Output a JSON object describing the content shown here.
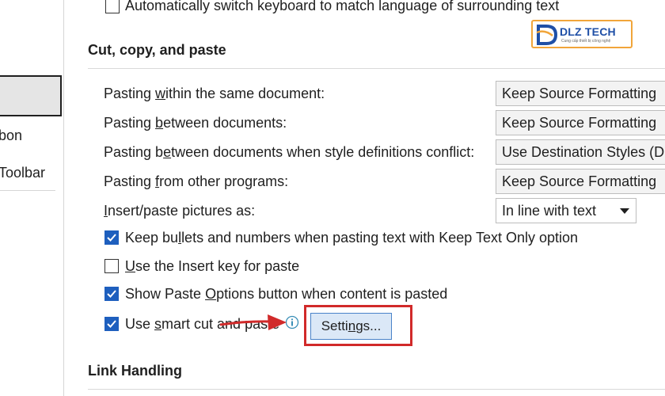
{
  "sidebar": {
    "partial_items": [
      {
        "label": "bon"
      },
      {
        "label": "Toolbar"
      }
    ]
  },
  "main": {
    "top_option": {
      "label": "Automatically switch keyboard to match language of surrounding text",
      "checked": false
    },
    "cut_copy_paste": {
      "title": "Cut, copy, and paste",
      "combos": [
        {
          "label": "Pasting within the same document:",
          "value": "Keep Source Formatting"
        },
        {
          "label": "Pasting between documents:",
          "value": "Keep Source Formatting"
        },
        {
          "label": "Pasting between documents when style definitions conflict:",
          "value": "Use Destination Styles (D"
        },
        {
          "label": "Pasting from other programs:",
          "value": "Keep Source Formatting"
        },
        {
          "label": "Insert/paste pictures as:",
          "value": "In line with text"
        }
      ],
      "checkboxes": [
        {
          "label": "Keep bullets and numbers when pasting text with Keep Text Only option",
          "checked": true
        },
        {
          "label": "Use the Insert key for paste",
          "checked": false
        },
        {
          "label": "Show Paste Options button when content is pasted",
          "checked": true
        },
        {
          "label": "Use smart cut and paste",
          "checked": true
        }
      ],
      "settings_button": "Settings..."
    },
    "link_handling": {
      "title": "Link Handling"
    }
  },
  "logo": {
    "text": "DLZ TECH",
    "tagline": "Cung cấp thiết bị công nghệ"
  },
  "colors": {
    "checkbox_checked": "#1e5fbe",
    "annotation_red": "#d12a2a",
    "logo_orange": "#f1a53a",
    "logo_blue": "#1f4fa6"
  },
  "icons": [
    "checkmark-icon",
    "info-icon",
    "chevron-down-icon",
    "red-arrow-annotation"
  ]
}
